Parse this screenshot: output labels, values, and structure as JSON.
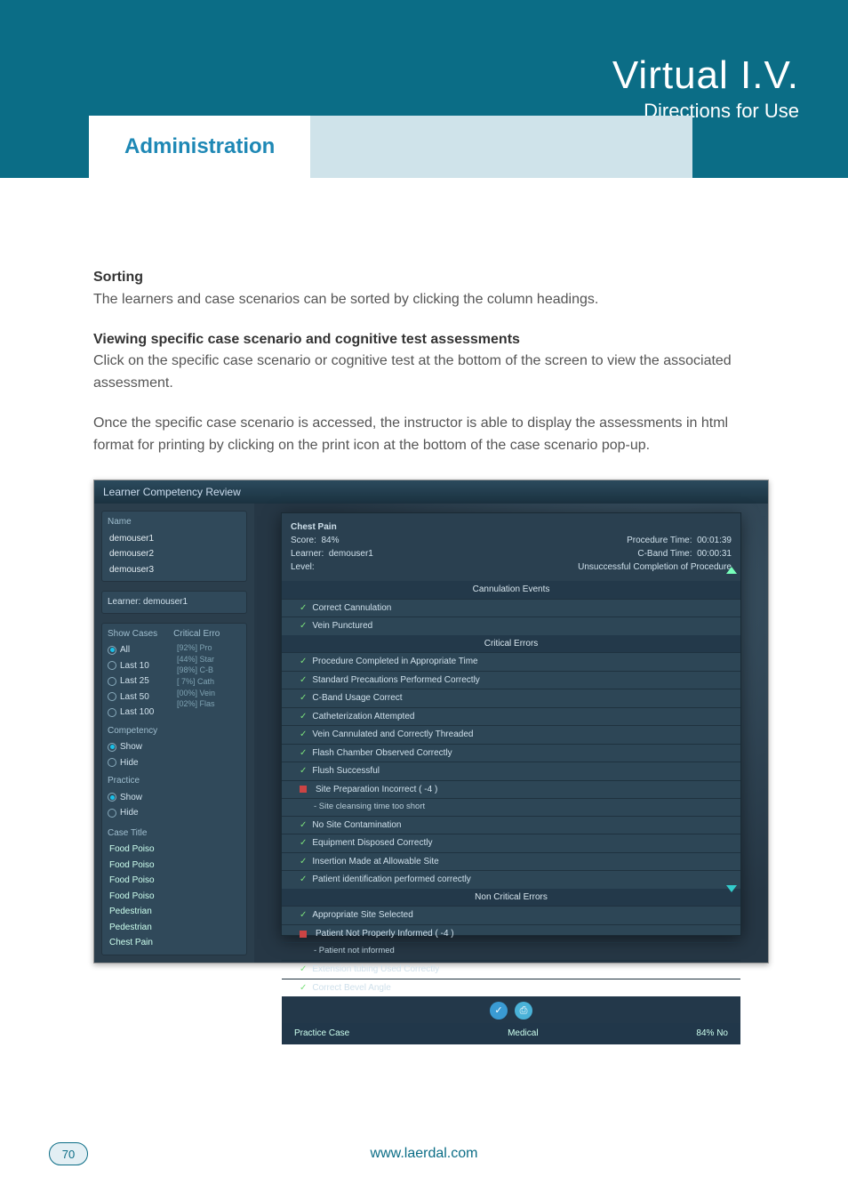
{
  "header": {
    "title": "Virtual I.V.",
    "subtitle": "Directions for Use",
    "tab_active": "Administration"
  },
  "body": {
    "h_sorting": "Sorting",
    "p_sorting": "The learners and case scenarios can be sorted by clicking the column headings.",
    "h_view": "Viewing specific case scenario and cognitive test assessments",
    "p_view": "Click on the specific case scenario or cognitive test at the bottom of the screen to view the associated assessment.",
    "p_view2": "Once the specific case scenario is accessed, the instructor is able to display the assessments in html format for printing by clicking on the print icon at the bottom of the case scenario pop-up."
  },
  "screenshot": {
    "window_title": "Learner Competency Review",
    "left": {
      "name_label": "Name",
      "learners": [
        "demouser1",
        "demouser2",
        "demouser3"
      ],
      "learner_sel_label": "Learner:",
      "learner_sel_value": "demouser1",
      "show_cases_label": "Show Cases",
      "critical_label": "Critical Erro",
      "cases_filters": [
        {
          "label": "All",
          "selected": true
        },
        {
          "label": "Last 10",
          "selected": false
        },
        {
          "label": "Last 25",
          "selected": false
        },
        {
          "label": "Last 50",
          "selected": false
        },
        {
          "label": "Last 100",
          "selected": false
        }
      ],
      "competency_label": "Competency",
      "competency_opts": [
        {
          "label": "Show",
          "selected": true
        },
        {
          "label": "Hide",
          "selected": false
        }
      ],
      "practice_label": "Practice",
      "practice_opts": [
        {
          "label": "Show",
          "selected": true
        },
        {
          "label": "Hide",
          "selected": false
        }
      ],
      "stats_lines": [
        "[92%]  Pro",
        "[44%]  Star",
        "[98%]  C-B",
        "[  7%]  Cath",
        "[00%]  Vein",
        "[02%]  Flas"
      ],
      "case_title_label": "Case Title",
      "cases": [
        "Food Poiso",
        "Food Poiso",
        "Food Poiso",
        "Food Poiso",
        "Pedestrian",
        "Pedestrian",
        "Chest Pain"
      ]
    },
    "popup": {
      "title": "Chest Pain",
      "score_label": "Score:",
      "score_value": "84%",
      "learner_label": "Learner:",
      "learner_value": "demouser1",
      "level_label": "Level:",
      "proc_time_label": "Procedure Time:",
      "proc_time_value": "00:01:39",
      "cband_label": "C-Band Time:",
      "cband_value": "00:00:31",
      "status": "Unsuccessful Completion of Procedure",
      "sections": {
        "cannulation_title": "Cannulation Events",
        "cannulation_items": [
          "Correct Cannulation",
          "Vein Punctured"
        ],
        "critical_title": "Critical Errors",
        "critical_items": [
          {
            "text": "Procedure Completed in Appropriate Time",
            "ok": true
          },
          {
            "text": "Standard Precautions Performed Correctly",
            "ok": true
          },
          {
            "text": "C-Band Usage Correct",
            "ok": true
          },
          {
            "text": "Catheterization Attempted",
            "ok": true
          },
          {
            "text": "Vein Cannulated and Correctly Threaded",
            "ok": true
          },
          {
            "text": "Flash Chamber Observed Correctly",
            "ok": true
          },
          {
            "text": "Flush Successful",
            "ok": true
          },
          {
            "text": "Site Preparation Incorrect ( -4 )",
            "ok": false,
            "sub": "- Site cleansing time too short"
          },
          {
            "text": "No Site Contamination",
            "ok": true
          },
          {
            "text": "Equipment Disposed Correctly",
            "ok": true
          },
          {
            "text": "Insertion Made at Allowable Site",
            "ok": true
          },
          {
            "text": "Patient identification performed correctly",
            "ok": true
          }
        ],
        "noncrit_title": "Non Critical Errors",
        "noncrit_items": [
          {
            "text": "Appropriate Site Selected",
            "ok": true
          },
          {
            "text": "Patient Not Properly Informed ( -4 )",
            "ok": false,
            "sub": "- Patient not informed"
          },
          {
            "text": "Extension tubing Used Correctly",
            "ok": true
          },
          {
            "text": "Correct Bevel Angle",
            "ok": true
          }
        ]
      },
      "footer": {
        "left": "Practice Case",
        "mid": "Medical",
        "right": "84%  No"
      }
    }
  },
  "footer": {
    "page_no": "70",
    "url": "www.laerdal.com"
  }
}
